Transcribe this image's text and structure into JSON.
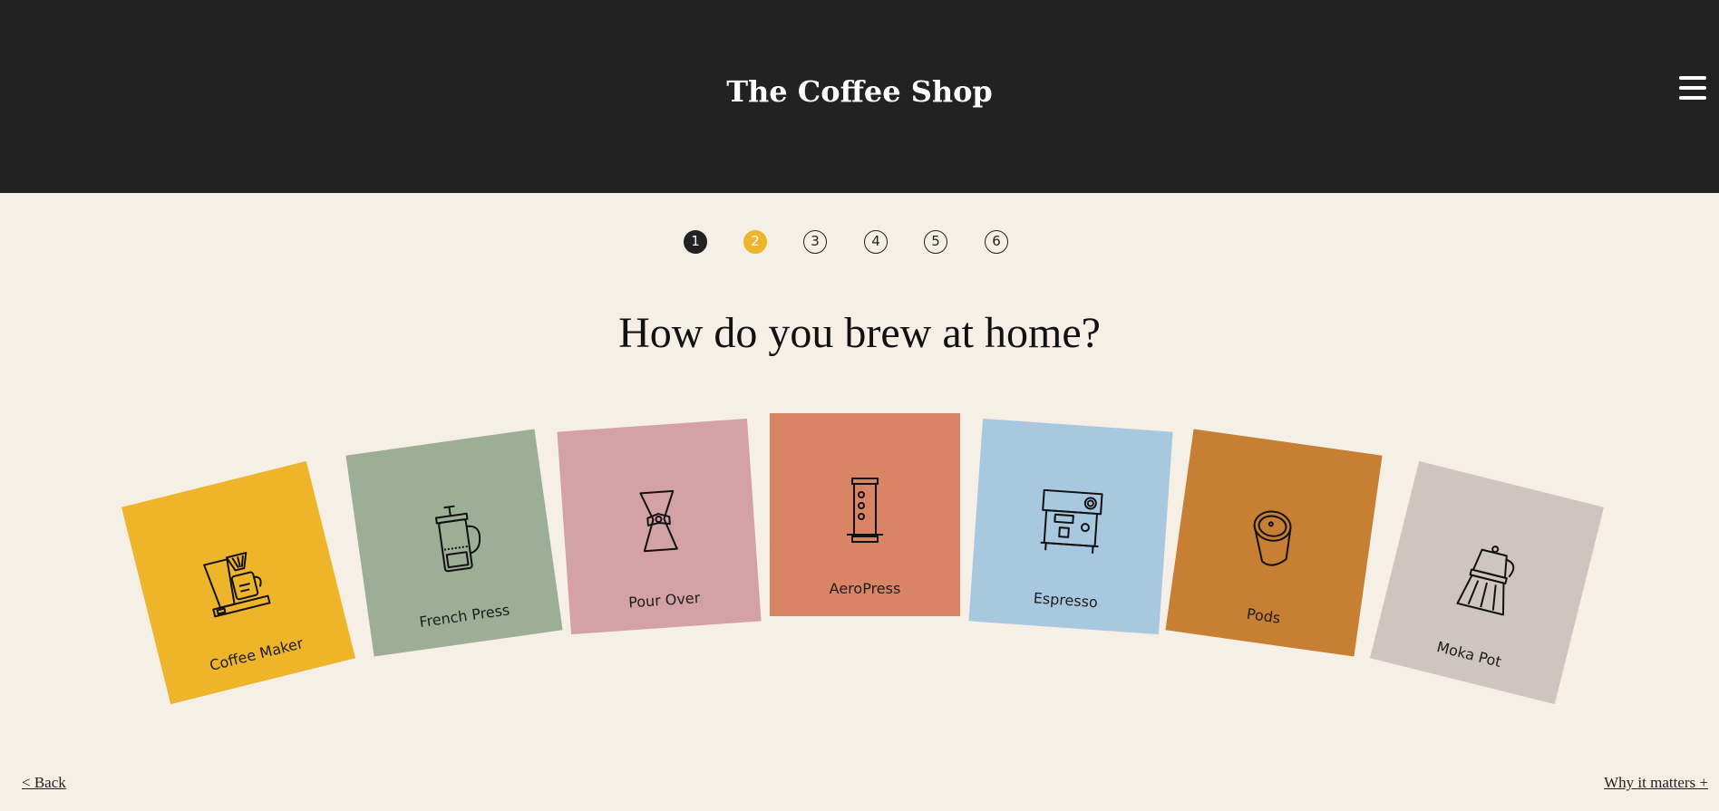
{
  "header": {
    "title": "The Coffee Shop"
  },
  "steps": [
    "1",
    "2",
    "3",
    "4",
    "5",
    "6"
  ],
  "question": "How do you brew at home?",
  "cards": [
    {
      "label": "Coffee Maker",
      "color": "#eeb42a",
      "icon": "coffee-maker-icon"
    },
    {
      "label": "French Press",
      "color": "#9cae96",
      "icon": "french-press-icon"
    },
    {
      "label": "Pour Over",
      "color": "#d4a1a6",
      "icon": "pour-over-icon"
    },
    {
      "label": "AeroPress",
      "color": "#d98565",
      "icon": "aeropress-icon"
    },
    {
      "label": "Espresso",
      "color": "#a8c8e0",
      "icon": "espresso-machine-icon"
    },
    {
      "label": "Pods",
      "color": "#c67f33",
      "icon": "coffee-pod-icon"
    },
    {
      "label": "Moka Pot",
      "color": "#cfc5c0",
      "icon": "moka-pot-icon"
    }
  ],
  "footer": {
    "back": "< Back",
    "why": "Why it matters +"
  }
}
